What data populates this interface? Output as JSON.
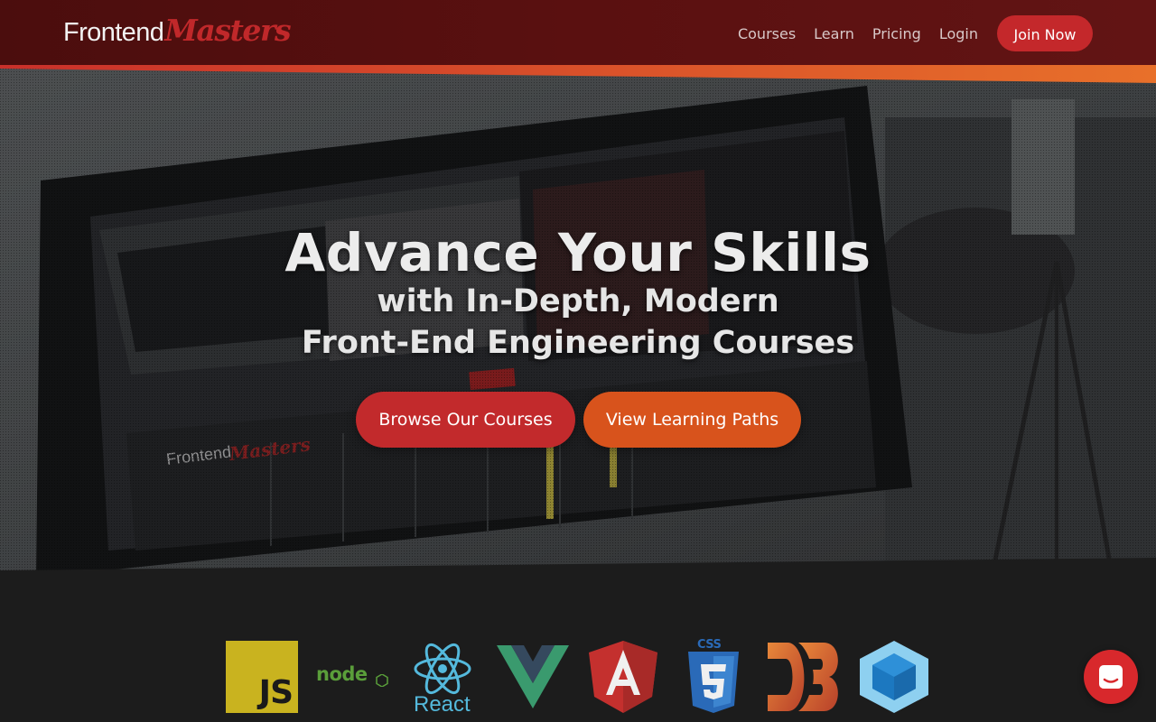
{
  "header": {
    "logo_front": "Frontend",
    "logo_masters": "Masters",
    "nav": [
      "Courses",
      "Learn",
      "Pricing",
      "Login"
    ],
    "join_label": "Join Now"
  },
  "hero": {
    "headline": "Advance Your Skills",
    "subline1": "with In-Depth, Modern",
    "subline2": "Front-End Engineering Courses",
    "cta_browse": "Browse Our Courses",
    "cta_paths": "View Learning Paths"
  },
  "tech_logos": [
    {
      "name": "javascript-icon",
      "label": "JS"
    },
    {
      "name": "node-icon",
      "label": "node"
    },
    {
      "name": "react-icon",
      "label": "React"
    },
    {
      "name": "vue-icon",
      "label": ""
    },
    {
      "name": "angular-icon",
      "label": "A"
    },
    {
      "name": "css3-icon",
      "label": "CSS"
    },
    {
      "name": "d3-icon",
      "label": ""
    },
    {
      "name": "webpack-icon",
      "label": ""
    }
  ],
  "chat": {
    "icon": "chat-icon"
  },
  "colors": {
    "brand_red": "#c4282b",
    "brand_orange": "#d8531c",
    "header_bg": "#4b0d0d",
    "footer_bg": "#1c1c1c"
  }
}
